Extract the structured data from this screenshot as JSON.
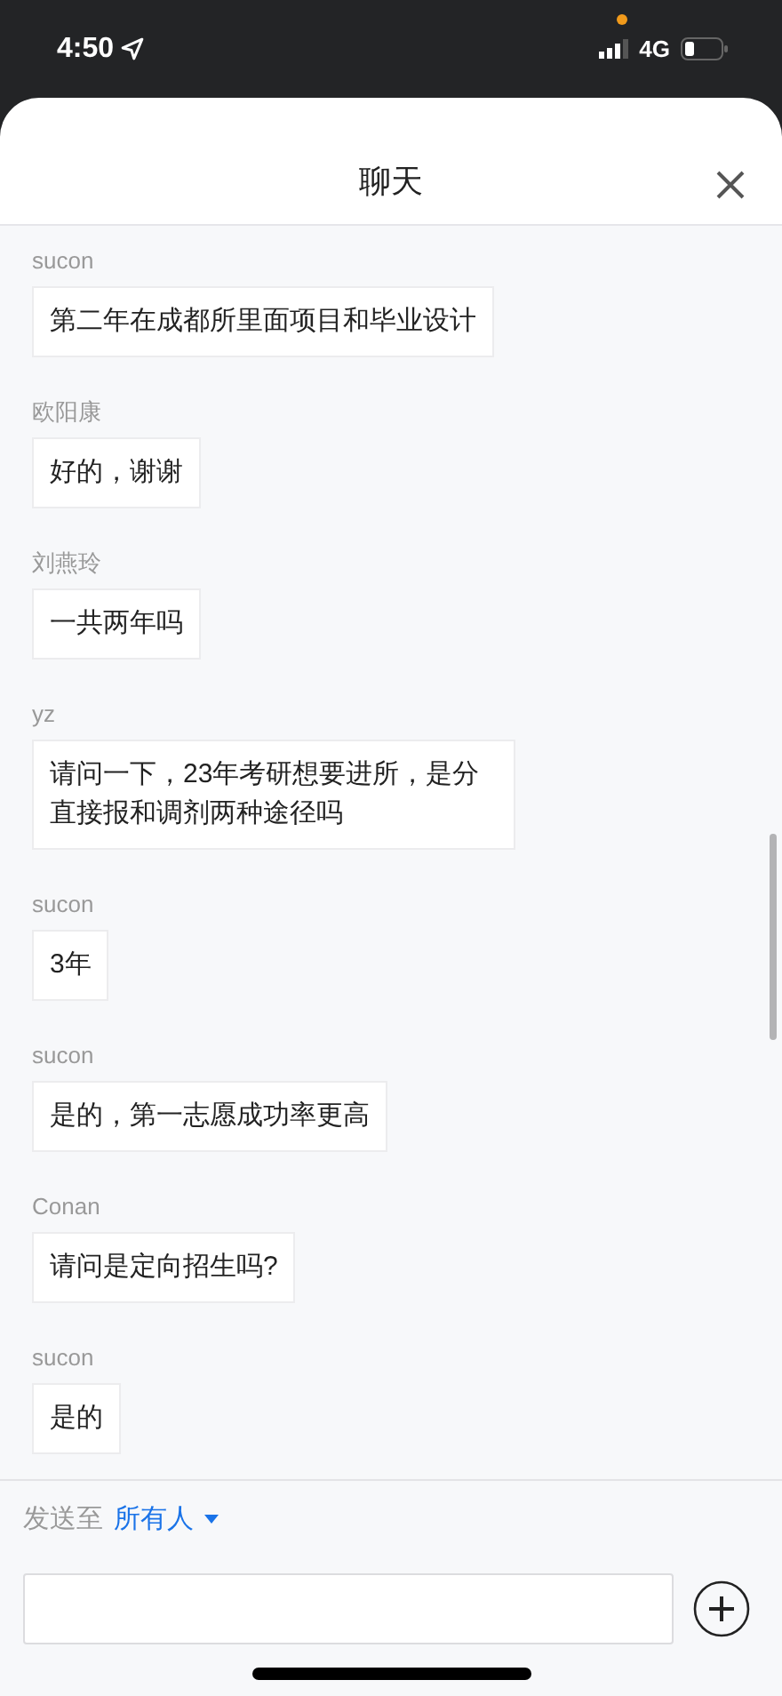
{
  "status_bar": {
    "time": "4:50",
    "network": "4G"
  },
  "header": {
    "title": "聊天"
  },
  "messages": [
    {
      "sender": "sucon",
      "text": "第二年在成都所里面项目和毕业设计"
    },
    {
      "sender": "欧阳康",
      "text": "好的，谢谢"
    },
    {
      "sender": "刘燕玲",
      "text": "一共两年吗"
    },
    {
      "sender": "yz",
      "text": "请问一下，23年考研想要进所，是分直接报和调剂两种途径吗"
    },
    {
      "sender": "sucon",
      "text": "3年"
    },
    {
      "sender": "sucon",
      "text": "是的，第一志愿成功率更高"
    },
    {
      "sender": "Conan",
      "text": "请问是定向招生吗?"
    },
    {
      "sender": "sucon",
      "text": "是的"
    }
  ],
  "composer": {
    "send_to_label": "发送至",
    "recipient": "所有人"
  }
}
